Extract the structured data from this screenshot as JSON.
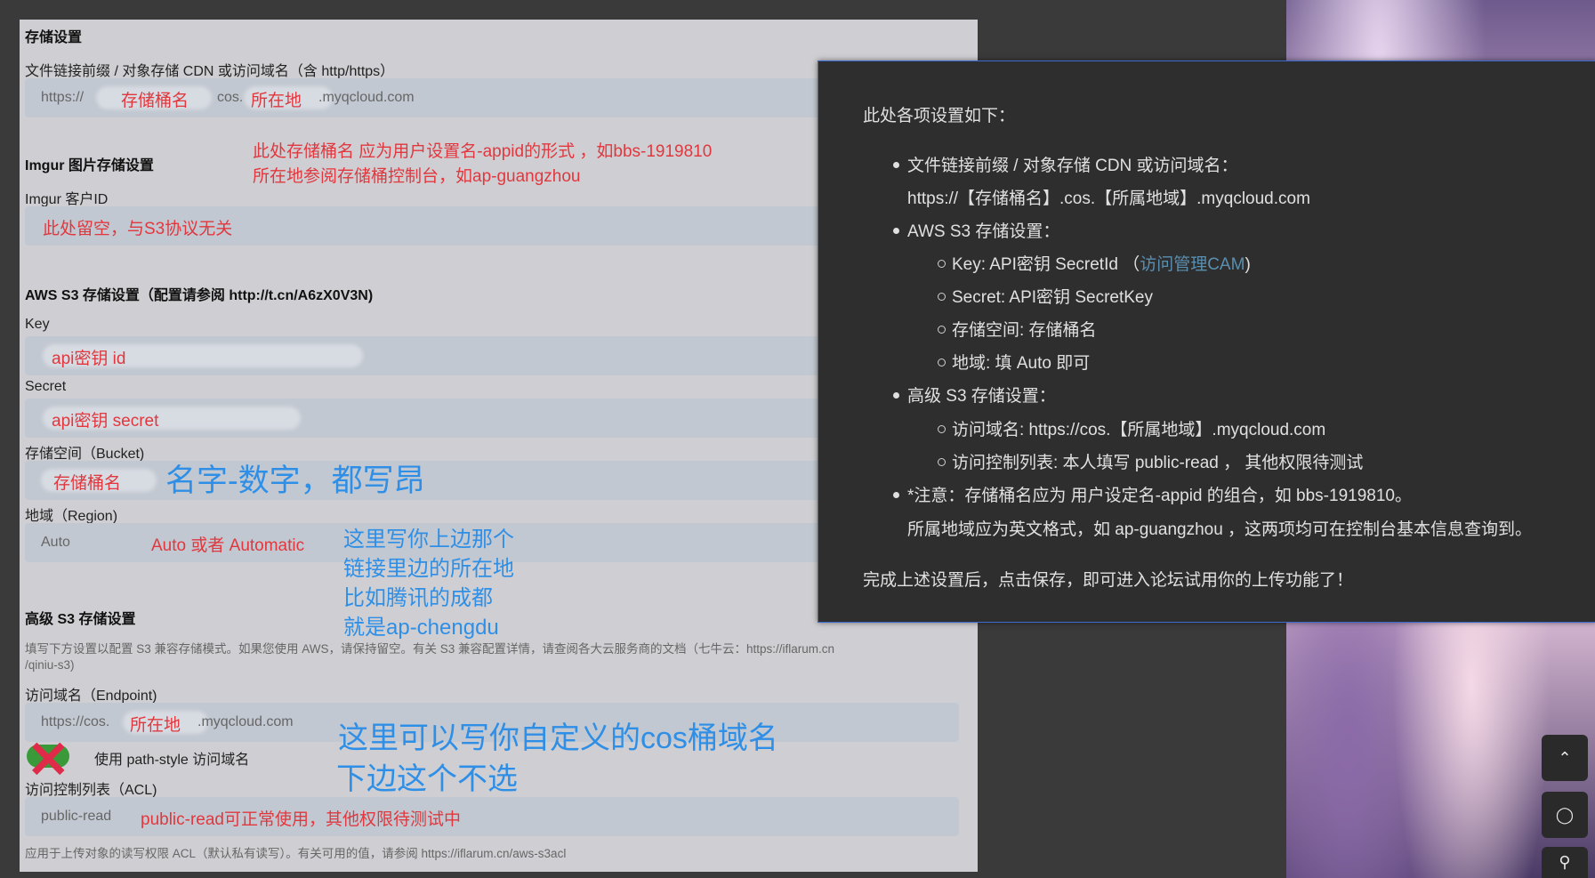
{
  "settings": {
    "title": "存储设置",
    "url_prefix_label": "文件链接前缀 / 对象存储 CDN 或访问域名（含 http/https）",
    "url_prefix_value": {
      "a": "https://",
      "b": "cos.",
      "c": ".myqcloud.com"
    },
    "imgur_header": "Imgur 图片存储设置",
    "imgur_client_label": "Imgur 客户ID",
    "aws_header": "AWS S3 存储设置（配置请参阅 http://t.cn/A6zX0V3N)",
    "key_label": "Key",
    "secret_label": "Secret",
    "bucket_label": "存储空间（Bucket)",
    "region_label": "地域（Region)",
    "region_value": "Auto",
    "advanced_header": "高级 S3 存储设置",
    "advanced_help_1": "填写下方设置以配置 S3 兼容存储模式。如果您使用 AWS，请保持留空。有关 S3 兼容配置详情，请查阅各大云服务商的文档（七牛云：https://iflarum.cn",
    "advanced_help_2": "/qiniu-s3)",
    "endpoint_label": "访问域名（Endpoint)",
    "endpoint_value": {
      "a": "https://cos.",
      "b": ".myqcloud.com"
    },
    "path_style_label": "使用 path-style 访问域名",
    "acl_label": "访问控制列表（ACL)",
    "acl_value": "public-read",
    "acl_help": "应用于上传对象的读写权限 ACL（默认私有读写）。有关可用的值，请参阅 https://iflarum.cn/aws-s3acl"
  },
  "annotations": {
    "bucket_name": "存储桶名",
    "location": "所在地",
    "bucket_note_1": "此处存储桶名 应为用户设置名-appid的形式 ，如bbs-1919810",
    "bucket_note_2": "所在地参阅存储桶控制台，如ap-guangzhou",
    "imgur_note": "此处留空，与S3协议无关",
    "key_note": "api密钥 id",
    "secret_note": "api密钥 secret",
    "bucket_field_note": "存储桶名",
    "bucket_big": "名字-数字，都写昂",
    "region_note": "Auto 或者 Automatic",
    "region_blue_1": "这里写你上边那个",
    "region_blue_2": "链接里边的所在地",
    "region_blue_3": "比如腾讯的成都",
    "region_blue_4": "就是ap-chengdu",
    "endpoint_location": "所在地",
    "endpoint_big_1": "这里可以写你自定义的cos桶域名",
    "endpoint_big_2": "下边这个不选",
    "acl_note": "public-read可正常使用，其他权限待测试中"
  },
  "card": {
    "intro": "此处各项设置如下：",
    "b1": "文件链接前缀 / 对象存储 CDN 或访问域名：",
    "b1_value": "https://【存储桶名】.cos.【所属地域】.myqcloud.com",
    "b2": "AWS S3 存储设置：",
    "b2_key": "Key: API密钥 SecretId （",
    "b2_key_link": "访问管理CAM",
    "b2_key_close": ")",
    "b2_secret": "Secret: API密钥 SecretKey",
    "b2_space": "存储空间: 存储桶名",
    "b2_region": "地域: 填 Auto 即可",
    "b3": "高级 S3 存储设置：",
    "b3_endpoint": "访问域名: https://cos.【所属地域】.myqcloud.com",
    "b3_acl": "访问控制列表: 本人填写 public-read ， 其他权限待测试",
    "b4": "*注意：存储桶名应为 用户设定名-appid 的组合，如 bbs-1919810。",
    "b4_2": "所属地域应为英文格式，如 ap-guangzhou ，这两项均可在控制台基本信息查询到。",
    "outro": "完成上述设置后，点击保存，即可进入论坛试用你的上传功能了！"
  },
  "fab": {
    "up": "⌃",
    "comment": "◯",
    "pin": "⚲"
  },
  "colors": {
    "annotation_red": "#e0383e",
    "annotation_blue": "#2f8fe6",
    "card_border": "#3b6bd0"
  }
}
